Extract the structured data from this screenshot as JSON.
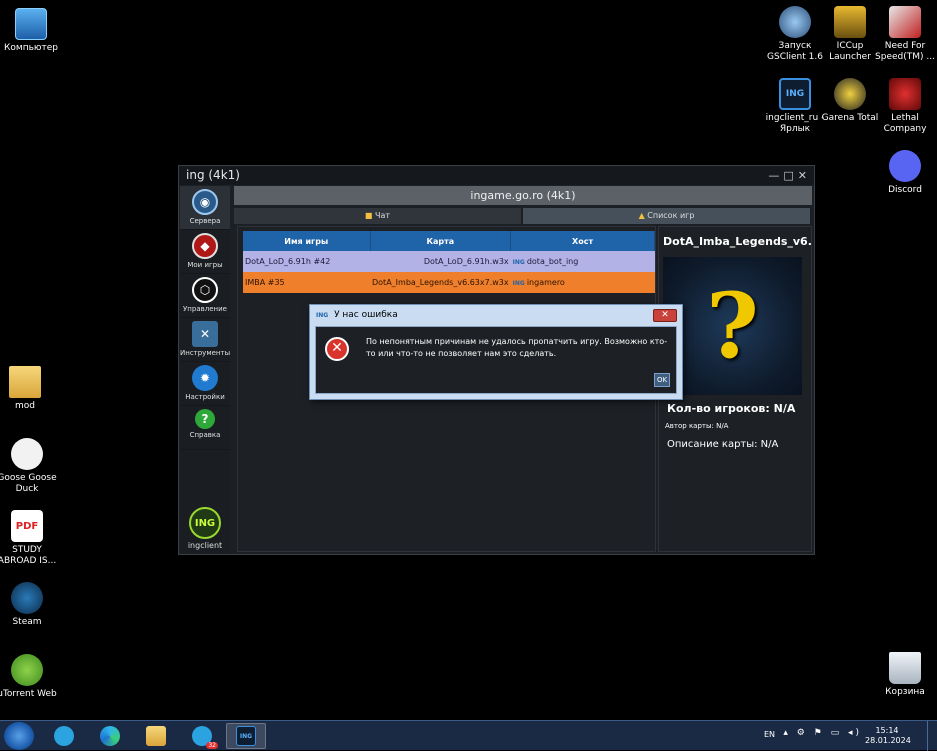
{
  "desktop": {
    "icons": [
      {
        "label": "Компьютер",
        "icon": "computer-icon"
      },
      {
        "label": "mod",
        "icon": "folder-icon"
      },
      {
        "label": "Goose Goose Duck",
        "icon": "goose-icon"
      },
      {
        "label": "STUDY ABROAD IS...",
        "icon": "pdf-icon",
        "badge": "PDF"
      },
      {
        "label": "Steam",
        "icon": "steam-icon"
      },
      {
        "label": "uTorrent Web",
        "icon": "utorrent-icon"
      },
      {
        "label": "Запуск GSClient 1.6",
        "icon": "gsclient-icon"
      },
      {
        "label": "ICCup Launcher",
        "icon": "iccup-icon"
      },
      {
        "label": "Need For Speed(TM) ...",
        "icon": "nfs-icon"
      },
      {
        "label": "ingclient_ru - Ярлык",
        "icon": "ingclient-icon",
        "badge": "ING"
      },
      {
        "label": "Garena Total",
        "icon": "garena-icon"
      },
      {
        "label": "Lethal Company",
        "icon": "lethal-company-icon"
      },
      {
        "label": "Discord",
        "icon": "discord-icon"
      },
      {
        "label": "Корзина",
        "icon": "recycle-bin-icon"
      }
    ]
  },
  "app": {
    "title": "ing (4k1)",
    "controls": "—□✕",
    "sidebar": [
      {
        "label": "Сервера",
        "glyph": "◉"
      },
      {
        "label": "Мои игры",
        "glyph": "◆"
      },
      {
        "label": "Управление",
        "glyph": "⬡"
      },
      {
        "label": "Инструменты",
        "glyph": "✕"
      },
      {
        "label": "Настройки",
        "glyph": "✹"
      },
      {
        "label": "Справка",
        "glyph": "?"
      }
    ],
    "brand": {
      "label": "ingclient",
      "badge": "ING"
    },
    "server": "ingame.go.ro (4k1)",
    "tabs": [
      {
        "label": "Чат",
        "icon": "chat-icon"
      },
      {
        "label": "Список игр",
        "icon": "list-icon"
      }
    ],
    "table": {
      "headers": [
        "Имя игры",
        "Карта",
        "Хост"
      ],
      "host_badge": "ING",
      "rows": [
        {
          "name": "DotA_LoD_6.91h #42",
          "map": "DotA_LoD_6.91h.w3x",
          "host": "dota_bot_ing"
        },
        {
          "name": "IMBA #35",
          "map": "DotA_Imba_Legends_v6.63x7.w3x",
          "host": "ingamero"
        }
      ]
    },
    "info": {
      "title": "DotA_Imba_Legends_v6.",
      "preview_glyph": "?",
      "players": "Кол-во игроков: N/A",
      "author": "Автор карты: N/A",
      "description": "Описание карты: N/A"
    }
  },
  "dialog": {
    "title": "У нас ошибка",
    "title_badge": "ING",
    "close_glyph": "✕",
    "icon_glyph": "✕",
    "message": "По непонятным причинам не удалось пропатчить игру. Возможно кто-то или что-то не позволяет нам это сделать.",
    "ok": "OK"
  },
  "taskbar": {
    "lang": "EN",
    "tray_glyphs": "▴ ⚙ ⚑ ▭ ◂)",
    "time": "15:14",
    "date": "28.01.2024",
    "telegram_badge": "32",
    "ing_badge": "ING"
  },
  "colors": {
    "accent": "#1f63a8",
    "row1": "#b3b2e6",
    "row2": "#f07f2c",
    "error": "#d9342b"
  }
}
